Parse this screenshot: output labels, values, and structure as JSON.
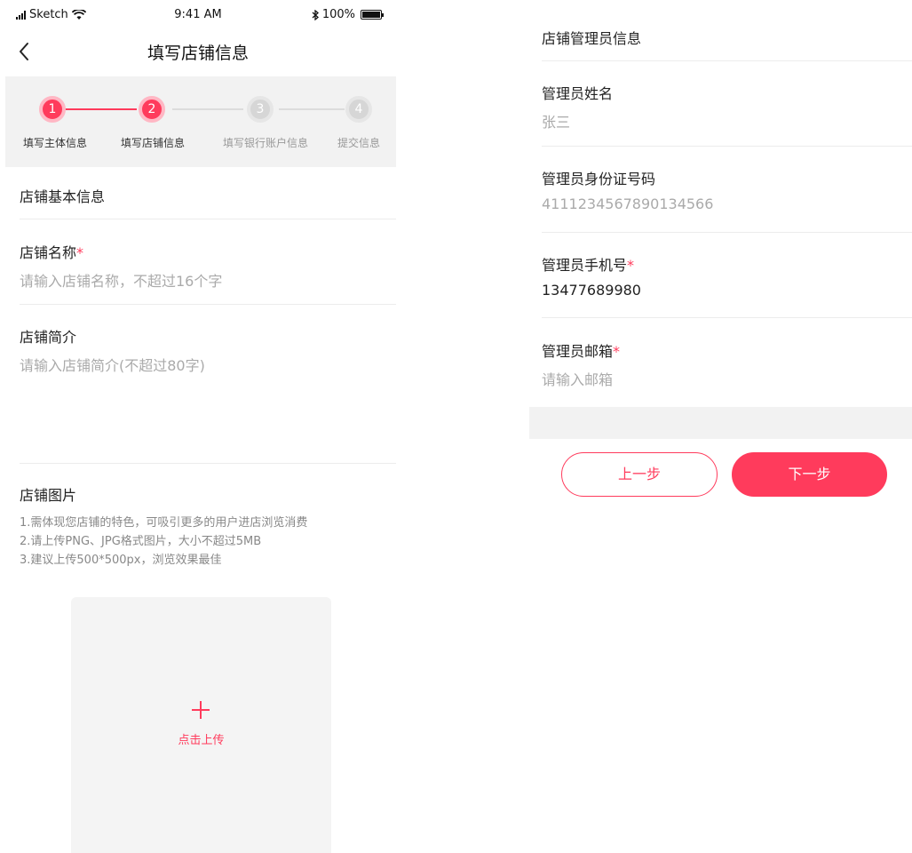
{
  "status_bar": {
    "carrier": "Sketch",
    "time": "9:41 AM",
    "battery": "100%"
  },
  "nav": {
    "title": "填写店铺信息"
  },
  "stepper": {
    "steps": [
      {
        "number": "1",
        "label": "填写主体信息",
        "state": "active"
      },
      {
        "number": "2",
        "label": "填写店铺信息",
        "state": "active"
      },
      {
        "number": "3",
        "label": "填写银行账户信息",
        "state": "inactive"
      },
      {
        "number": "4",
        "label": "提交信息",
        "state": "inactive"
      }
    ]
  },
  "basic_info": {
    "section_title": "店铺基本信息",
    "name_label": "店铺名称",
    "name_required_mark": "*",
    "name_placeholder": "请输入店铺名称，不超过16个字",
    "intro_label": "店铺简介",
    "intro_placeholder": "请输入店铺简介(不超过80字)"
  },
  "images": {
    "section_title": "店铺图片",
    "notes": [
      "1.需体现您店铺的特色，可吸引更多的用户进店浏览消费",
      "2.请上传PNG、JPG格式图片，大小不超过5MB",
      "3.建议上传500*500px，浏览效果最佳"
    ],
    "upload_label": "点击上传"
  },
  "admin_info": {
    "section_title": "店铺管理员信息",
    "name_label": "管理员姓名",
    "name_value": "张三",
    "id_label": "管理员身份证号码",
    "id_value": "4111234567890134566",
    "phone_label": "管理员手机号",
    "phone_required_mark": "*",
    "phone_value": "13477689980",
    "email_label": "管理员邮箱",
    "email_required_mark": "*",
    "email_placeholder": "请输入邮箱"
  },
  "actions": {
    "prev_label": "上一步",
    "next_label": "下一步"
  },
  "colors": {
    "accent": "#ff3b5c",
    "accent_light": "#ffb7c4",
    "inactive": "#d6d6d6",
    "band": "#f2f2f2"
  }
}
